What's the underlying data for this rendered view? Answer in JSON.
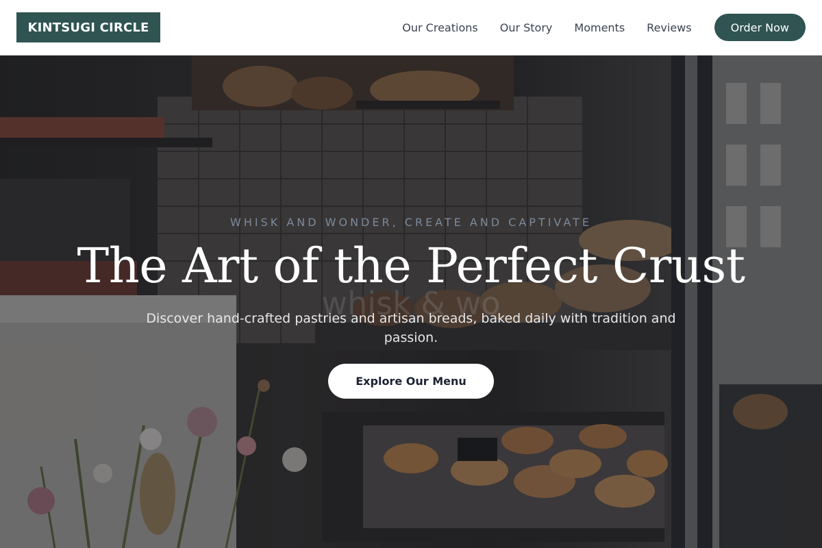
{
  "header": {
    "logo": "KINTSUGI CIRCLE",
    "nav": [
      "Our Creations",
      "Our Story",
      "Moments",
      "Reviews"
    ],
    "cta": "Order Now"
  },
  "hero": {
    "tagline": "WHISK AND WONDER, CREATE AND CAPTIVATE",
    "watermark": "whisk & wo",
    "title": "The Art of the Perfect Crust",
    "subtitle": "Discover hand-crafted pastries and artisan breads, baked daily with tradition and passion.",
    "button": "Explore Our Menu",
    "image_description": "Bakery shop window with breads, pastries on trays, flowers in foreground"
  },
  "colors": {
    "brand": "#2f5452",
    "nav_text": "#3a4250",
    "cta_text": "#1b2232"
  }
}
